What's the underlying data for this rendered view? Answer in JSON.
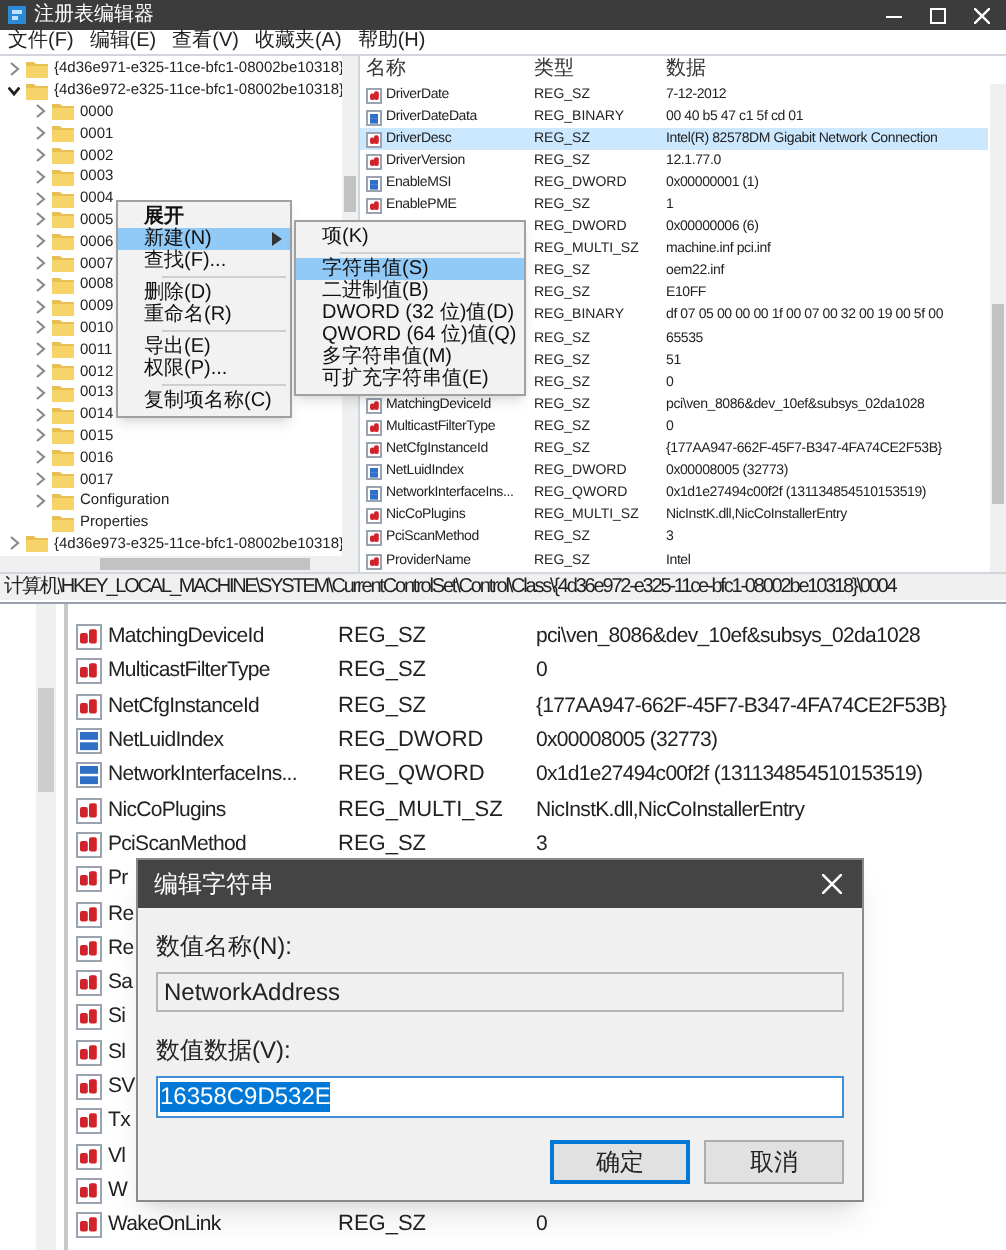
{
  "window": {
    "title": "注册表编辑器"
  },
  "menu": [
    "文件(F)",
    "编辑(E)",
    "查看(V)",
    "收藏夹(A)",
    "帮助(H)"
  ],
  "tree": [
    {
      "kind": "branch",
      "label": "{4d36e971-e325-11ce-bfc1-08002be10318}",
      "expanded": false
    },
    {
      "kind": "branch",
      "label": "{4d36e972-e325-11ce-bfc1-08002be10318}",
      "expanded": true,
      "children": [
        {
          "kind": "branch",
          "label": "0000",
          "expanded": false
        },
        {
          "kind": "branch",
          "label": "0001",
          "expanded": false
        },
        {
          "kind": "branch",
          "label": "0002",
          "expanded": false
        },
        {
          "kind": "branch",
          "label": "0003",
          "expanded": false
        },
        {
          "kind": "branch",
          "label": "0004",
          "expanded": false
        },
        {
          "kind": "branch",
          "label": "0005",
          "expanded": false
        },
        {
          "kind": "branch",
          "label": "0006",
          "expanded": false
        },
        {
          "kind": "branch",
          "label": "0007",
          "expanded": false
        },
        {
          "kind": "branch",
          "label": "0008",
          "expanded": false
        },
        {
          "kind": "branch",
          "label": "0009",
          "expanded": false
        },
        {
          "kind": "branch",
          "label": "0010",
          "expanded": false
        },
        {
          "kind": "branch",
          "label": "0011",
          "expanded": false
        },
        {
          "kind": "branch",
          "label": "0012",
          "expanded": false
        },
        {
          "kind": "branch",
          "label": "0013",
          "expanded": false
        },
        {
          "kind": "branch",
          "label": "0014",
          "expanded": false
        },
        {
          "kind": "branch",
          "label": "0015",
          "expanded": false
        },
        {
          "kind": "branch",
          "label": "0016",
          "expanded": false
        },
        {
          "kind": "branch",
          "label": "0017",
          "expanded": false
        },
        {
          "kind": "branch",
          "label": "Configuration",
          "expanded": false
        },
        {
          "kind": "leaf",
          "label": "Properties"
        }
      ]
    },
    {
      "kind": "branch",
      "label": "{4d36e973-e325-11ce-bfc1-08002be10318}",
      "expanded": false
    }
  ],
  "columns": [
    "名称",
    "类型",
    "数据"
  ],
  "values": [
    {
      "kind": "string",
      "name": "DriverDate",
      "type": "REG_SZ",
      "data": "7-12-2012",
      "selected": false
    },
    {
      "kind": "binary",
      "name": "DriverDateData",
      "type": "REG_BINARY",
      "data": "00 40 b5 47 c1 5f cd 01",
      "selected": false
    },
    {
      "kind": "string",
      "name": "DriverDesc",
      "type": "REG_SZ",
      "data": "Intel(R) 82578DM Gigabit Network Connection",
      "selected": true
    },
    {
      "kind": "string",
      "name": "DriverVersion",
      "type": "REG_SZ",
      "data": "12.1.77.0",
      "selected": false
    },
    {
      "kind": "binary",
      "name": "EnableMSI",
      "type": "REG_DWORD",
      "data": "0x00000001 (1)",
      "selected": false
    },
    {
      "kind": "string",
      "name": "EnablePME",
      "type": "REG_SZ",
      "data": "1",
      "selected": false
    },
    {
      "kind": "covered",
      "type": "REG_DWORD",
      "data": "0x00000006 (6)",
      "selected": false
    },
    {
      "kind": "covered",
      "type": "REG_MULTI_SZ",
      "data": "machine.inf pci.inf",
      "selected": false
    },
    {
      "kind": "covered",
      "type": "REG_SZ",
      "data": "oem22.inf",
      "selected": false
    },
    {
      "kind": "covered",
      "type": "REG_SZ",
      "data": "E10FF",
      "selected": false
    },
    {
      "kind": "covered",
      "type": "REG_BINARY",
      "data": "df 07 05 00 00 00 1f 00 07 00 32 00 19 00 5f 00",
      "selected": false
    },
    {
      "kind": "covered",
      "type": "REG_SZ",
      "data": "65535",
      "selected": false
    },
    {
      "kind": "covered",
      "type": "REG_SZ",
      "data": "51",
      "selected": false
    },
    {
      "kind": "covered",
      "type": "REG_SZ",
      "data": "0",
      "selected": false
    },
    {
      "kind": "string",
      "name": "MatchingDeviceId",
      "type": "REG_SZ",
      "data": "pci\\ven_8086&dev_10ef&subsys_02da1028",
      "selected": false
    },
    {
      "kind": "string",
      "name": "MulticastFilterType",
      "type": "REG_SZ",
      "data": "0",
      "selected": false
    },
    {
      "kind": "string",
      "name": "NetCfgInstanceId",
      "type": "REG_SZ",
      "data": "{177AA947-662F-45F7-B347-4FA74CE2F53B}",
      "selected": false
    },
    {
      "kind": "binary",
      "name": "NetLuidIndex",
      "type": "REG_DWORD",
      "data": "0x00008005 (32773)",
      "selected": false
    },
    {
      "kind": "binary",
      "name": "NetworkInterfaceIns...",
      "type": "REG_QWORD",
      "data": "0x1d1e27494c00f2f (131134854510153519)",
      "selected": false
    },
    {
      "kind": "string",
      "name": "NicCoPlugins",
      "type": "REG_MULTI_SZ",
      "data": "NicInstK.dll,NicCoInstallerEntry",
      "selected": false
    },
    {
      "kind": "string",
      "name": "PciScanMethod",
      "type": "REG_SZ",
      "data": "3",
      "selected": false
    },
    {
      "kind": "string",
      "name": "ProviderName",
      "type": "REG_SZ",
      "data": "Intel",
      "selected": false
    }
  ],
  "context_menu": [
    {
      "kind": "item",
      "label": "展开",
      "bold": true,
      "submenu": false,
      "selected": false
    },
    {
      "kind": "item",
      "label": "新建(N)",
      "bold": false,
      "submenu": true,
      "selected": true
    },
    {
      "kind": "item",
      "label": "查找(F)...",
      "bold": false,
      "submenu": false,
      "selected": false
    },
    {
      "kind": "separator"
    },
    {
      "kind": "item",
      "label": "删除(D)",
      "bold": false,
      "submenu": false,
      "selected": false
    },
    {
      "kind": "item",
      "label": "重命名(R)",
      "bold": false,
      "submenu": false,
      "selected": false
    },
    {
      "kind": "separator"
    },
    {
      "kind": "item",
      "label": "导出(E)",
      "bold": false,
      "submenu": false,
      "selected": false
    },
    {
      "kind": "item",
      "label": "权限(P)...",
      "bold": false,
      "submenu": false,
      "selected": false
    },
    {
      "kind": "separator"
    },
    {
      "kind": "item",
      "label": "复制项名称(C)",
      "bold": false,
      "submenu": false,
      "selected": false
    }
  ],
  "submenu": [
    {
      "kind": "item",
      "label": "项(K)",
      "selected": false
    },
    {
      "kind": "separator"
    },
    {
      "kind": "item",
      "label": "字符串值(S)",
      "selected": true
    },
    {
      "kind": "item",
      "label": "二进制值(B)",
      "selected": false
    },
    {
      "kind": "item",
      "label": "DWORD (32 位)值(D)",
      "selected": false
    },
    {
      "kind": "item",
      "label": "QWORD (64 位)值(Q)",
      "selected": false
    },
    {
      "kind": "item",
      "label": "多字符串值(M)",
      "selected": false
    },
    {
      "kind": "item",
      "label": "可扩充字符串值(E)",
      "selected": false
    }
  ],
  "status_bar": "计算机\\HKEY_LOCAL_MACHINE\\SYSTEM\\CurrentControlSet\\Control\\Class\\{4d36e972-e325-11ce-bfc1-08002be10318}\\0004",
  "zoom_values": [
    {
      "kind": "string",
      "name": "MatchingDeviceId",
      "type": "REG_SZ",
      "data": "pci\\ven_8086&dev_10ef&subsys_02da1028"
    },
    {
      "kind": "string",
      "name": "MulticastFilterType",
      "type": "REG_SZ",
      "data": "0"
    },
    {
      "kind": "string",
      "name": "NetCfgInstanceId",
      "type": "REG_SZ",
      "data": "{177AA947-662F-45F7-B347-4FA74CE2F53B}"
    },
    {
      "kind": "binary",
      "name": "NetLuidIndex",
      "type": "REG_DWORD",
      "data": "0x00008005 (32773)"
    },
    {
      "kind": "binary",
      "name": "NetworkInterfaceIns...",
      "type": "REG_QWORD",
      "data": "0x1d1e27494c00f2f (131134854510153519)"
    },
    {
      "kind": "string",
      "name": "NicCoPlugins",
      "type": "REG_MULTI_SZ",
      "data": "NicInstK.dll,NicCoInstallerEntry"
    },
    {
      "kind": "string",
      "name": "PciScanMethod",
      "type": "REG_SZ",
      "data": "3"
    },
    {
      "kind": "string",
      "name": "Pr"
    },
    {
      "kind": "string",
      "name": "Re"
    },
    {
      "kind": "string",
      "name": "Re"
    },
    {
      "kind": "string",
      "name": "Sa"
    },
    {
      "kind": "string",
      "name": "Si"
    },
    {
      "kind": "string",
      "name": "Sl"
    },
    {
      "kind": "string",
      "name": "SV"
    },
    {
      "kind": "string",
      "name": "Tx"
    },
    {
      "kind": "string",
      "name": "Vl"
    },
    {
      "kind": "string",
      "name": "W"
    },
    {
      "kind": "string",
      "name": "WakeOnLink",
      "type": "REG_SZ",
      "data": "0"
    }
  ],
  "dialog": {
    "title": "编辑字符串",
    "name_label": "数值名称(N):",
    "name_value": "NetworkAddress",
    "data_label": "数值数据(V):",
    "data_value": "16358C9D532E",
    "data_selected": true,
    "buttons": [
      {
        "label": "确定",
        "default": true
      },
      {
        "label": "取消",
        "default": false
      }
    ]
  }
}
